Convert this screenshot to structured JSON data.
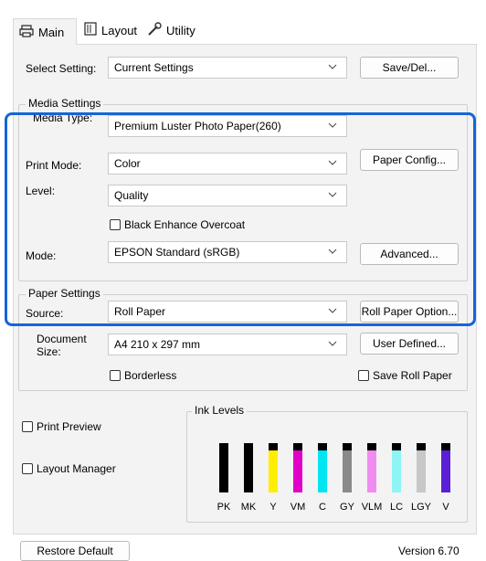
{
  "tabs": [
    {
      "label": "Main",
      "icon": "printer-icon",
      "active": true
    },
    {
      "label": "Layout",
      "icon": "layout-icon",
      "active": false
    },
    {
      "label": "Utility",
      "icon": "wrench-icon",
      "active": false
    }
  ],
  "select_setting": {
    "label": "Select Setting:",
    "value": "Current Settings",
    "button": "Save/Del..."
  },
  "media_settings": {
    "title": "Media Settings",
    "media_type": {
      "label": "Media Type:",
      "value": "Premium Luster Photo Paper(260)"
    },
    "print_mode": {
      "label": "Print Mode:",
      "value": "Color",
      "button": "Paper Config..."
    },
    "level": {
      "label": "Level:",
      "value": "Quality"
    },
    "black_enhance": {
      "label": "Black Enhance Overcoat",
      "checked": false
    },
    "mode": {
      "label": "Mode:",
      "value": "EPSON Standard (sRGB)",
      "button": "Advanced..."
    }
  },
  "paper_settings": {
    "title": "Paper Settings",
    "source": {
      "label": "Source:",
      "value": "Roll Paper",
      "button": "Roll Paper Option..."
    },
    "document_size": {
      "label": "Document Size:",
      "value": "A4 210 x 297 mm",
      "button": "User Defined..."
    },
    "borderless": {
      "label": "Borderless",
      "checked": false
    },
    "save_roll_paper": {
      "label": "Save Roll Paper",
      "checked": false
    }
  },
  "print_preview": {
    "label": "Print Preview",
    "checked": false
  },
  "layout_manager": {
    "label": "Layout Manager",
    "checked": false
  },
  "ink_levels": {
    "title": "Ink Levels",
    "inks": [
      {
        "name": "PK",
        "color": "#000000",
        "level": 1.0
      },
      {
        "name": "MK",
        "color": "#000000",
        "level": 1.0
      },
      {
        "name": "Y",
        "color": "#ffee00",
        "level": 0.85
      },
      {
        "name": "VM",
        "color": "#e000c8",
        "level": 0.85
      },
      {
        "name": "C",
        "color": "#00e5f0",
        "level": 0.85
      },
      {
        "name": "GY",
        "color": "#8a8a8a",
        "level": 0.85
      },
      {
        "name": "VLM",
        "color": "#f08cf0",
        "level": 0.85
      },
      {
        "name": "LC",
        "color": "#8ff4f4",
        "level": 0.85
      },
      {
        "name": "LGY",
        "color": "#c7c7c7",
        "level": 0.85
      },
      {
        "name": "V",
        "color": "#5a1fd6",
        "level": 0.85
      }
    ]
  },
  "restore_default": "Restore Default",
  "version": "Version 6.70"
}
